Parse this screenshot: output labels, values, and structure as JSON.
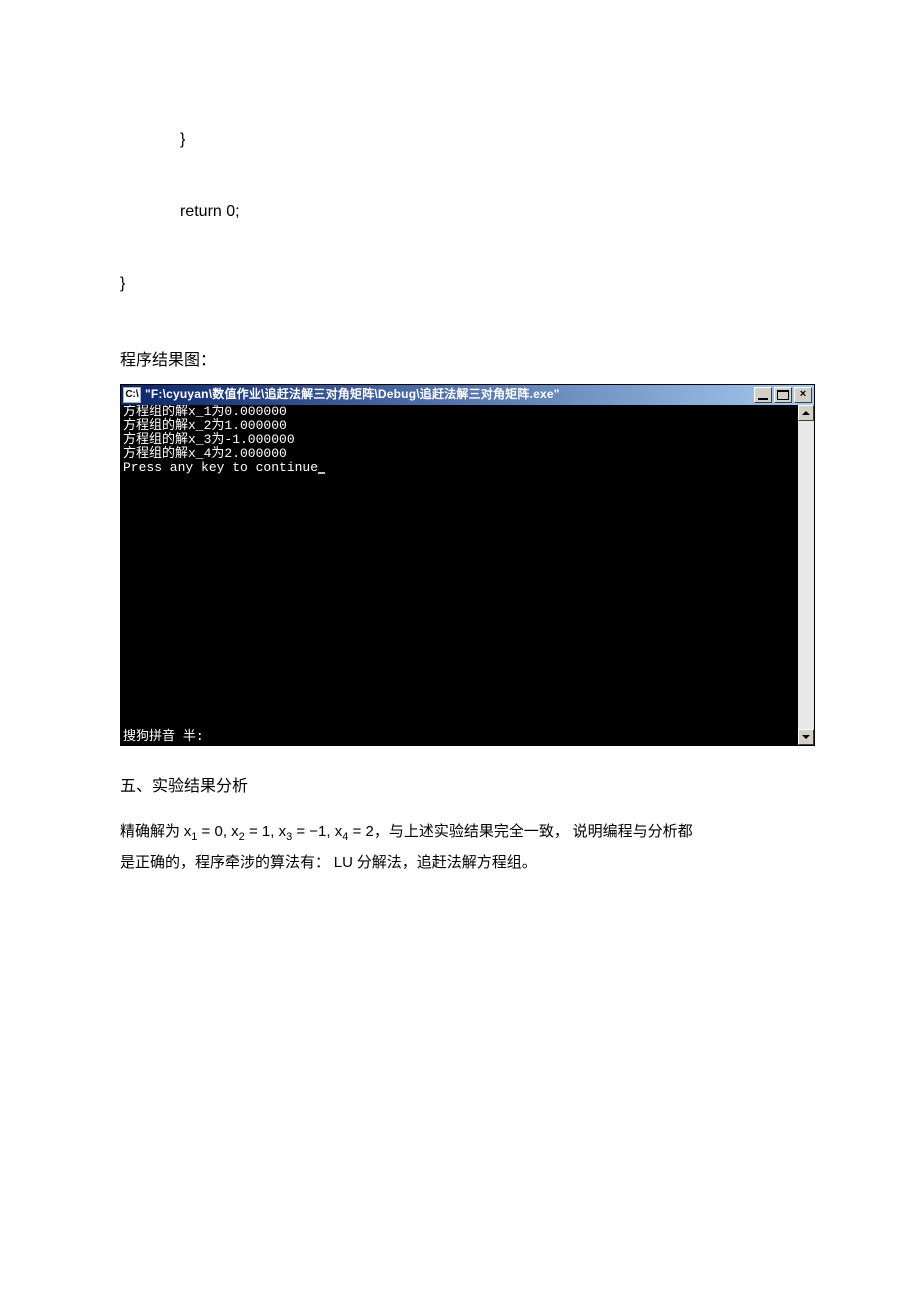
{
  "code": {
    "line1": "}",
    "line2": "return 0;",
    "line3": "}"
  },
  "caption": "程序结果图：",
  "console": {
    "icon_label": "C:\\",
    "title": "\"F:\\cyuyan\\数值作业\\追赶法解三对角矩阵\\Debug\\追赶法解三对角矩阵.exe\"",
    "lines": [
      "方程组的解x_1为0.000000",
      "方程组的解x_2为1.000000",
      "方程组的解x_3为-1.000000",
      "方程组的解x_4为2.000000",
      "Press any key to continue"
    ],
    "ime": "搜狗拼音 半:"
  },
  "section_title": "五、实验结果分析",
  "analysis": {
    "prefix": "精确解为 ",
    "eq_x1_lhs": "x",
    "eq_x1_sub": "1",
    "eq_x1_rhs": " = 0, ",
    "eq_x2_lhs": "x",
    "eq_x2_sub": "2",
    "eq_x2_rhs": " = 1, ",
    "eq_x3_lhs": "x",
    "eq_x3_sub": "3",
    "eq_x3_rhs": " = −1, ",
    "eq_x4_lhs": "x",
    "eq_x4_sub": "4",
    "eq_x4_rhs": " = 2",
    "tail1": "，与上述实验结果完全一致，  说明编程与分析都",
    "line2_a": "是正确的，程序牵涉的算法有：  ",
    "line2_lu": "LU",
    "line2_b": " 分解法，追赶法解方程组。"
  }
}
